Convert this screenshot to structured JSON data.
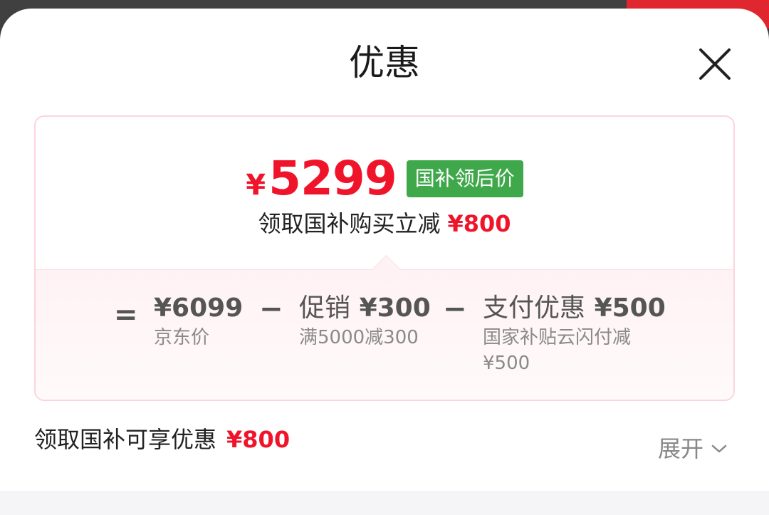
{
  "sheet": {
    "title": "优惠",
    "close_icon": "close-icon"
  },
  "card": {
    "final_currency": "¥",
    "final_amount": "5299",
    "badge": "国补领后价",
    "subline_text": "领取国补购买立减",
    "subline_amount": "¥800",
    "breakdown": {
      "eq": "=",
      "minus": "−",
      "jd_price": "¥6099",
      "jd_label": "京东价",
      "promo_name": "促销",
      "promo_amount": "¥300",
      "promo_desc": "满5000减300",
      "pay_name": "支付优惠",
      "pay_amount": "¥500",
      "pay_desc_line1": "国家补贴云闪付减",
      "pay_desc_line2": "¥500"
    }
  },
  "bottom": {
    "label": "领取国补可享优惠",
    "amount": "¥800",
    "expand_label": "展开",
    "expand_icon": "chevron-down-icon"
  },
  "colors": {
    "accent_red": "#f0142b",
    "badge_green": "#3fa84a",
    "card_border": "#fbd5dd"
  }
}
